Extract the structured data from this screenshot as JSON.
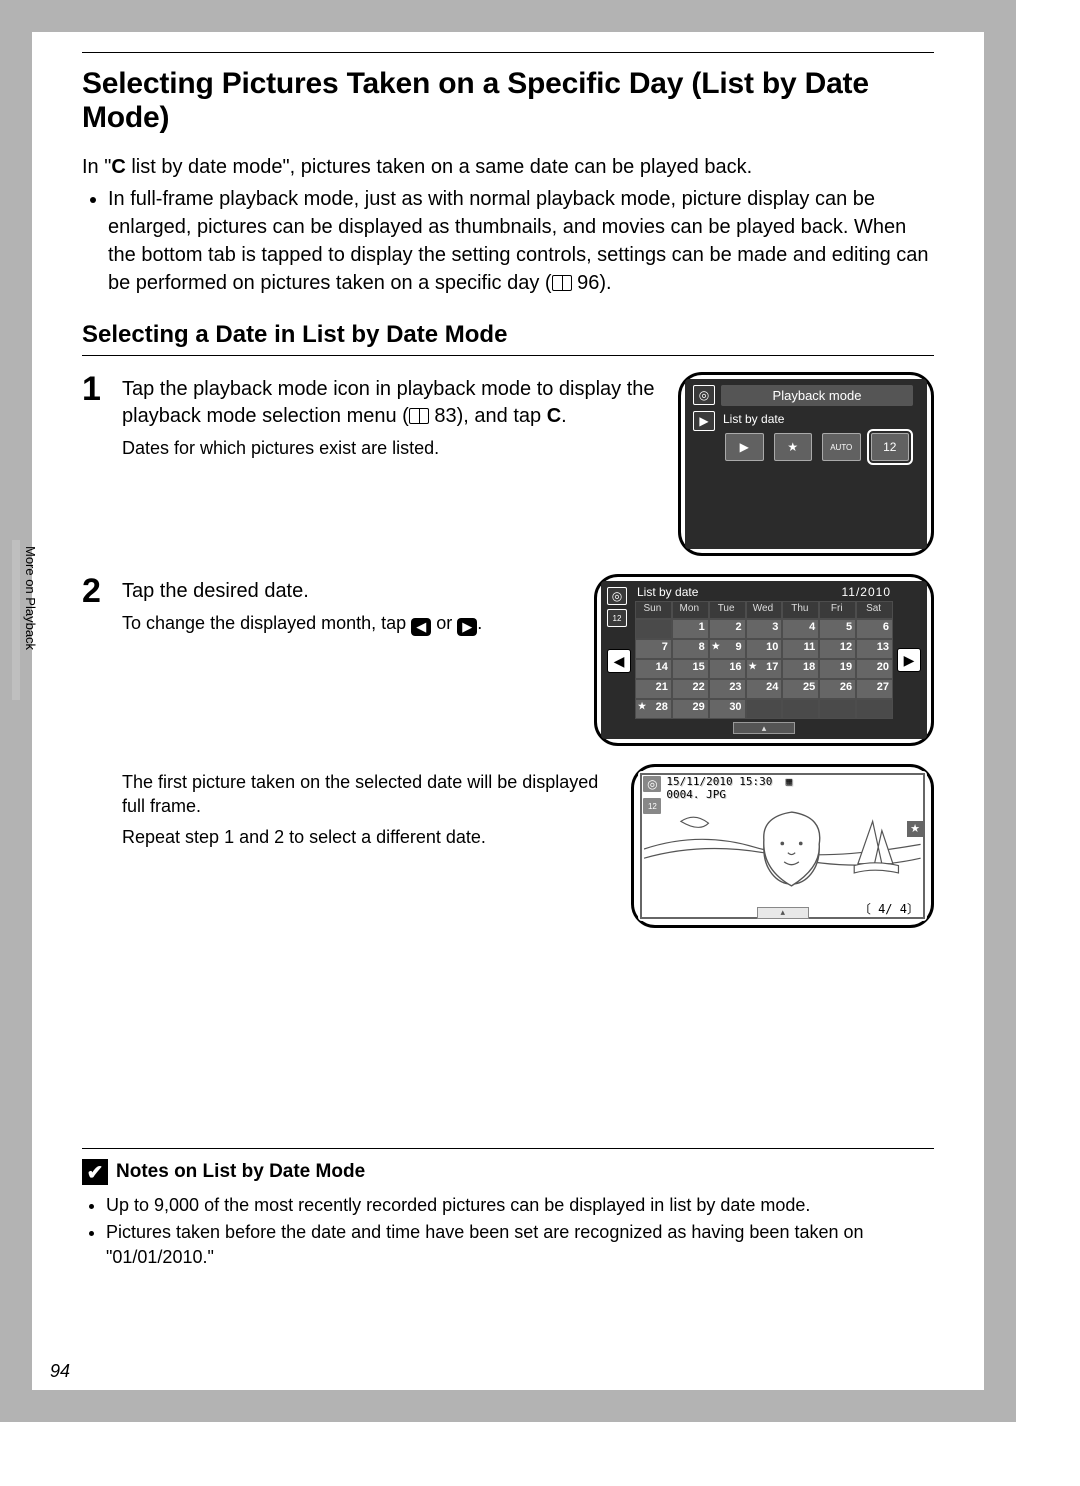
{
  "title": "Selecting Pictures Taken on a Specific Day (List by Date Mode)",
  "intro_prefix": "In \"",
  "intro_mode_icon": "C",
  "intro_suffix": " list by date mode\", pictures taken on a same date can be played back.",
  "bullet1": "In full-frame playback mode, just as with normal playback mode, picture display can be enlarged, pictures can be displayed as thumbnails, and movies can be played back. When the bottom tab is tapped to display the setting controls, settings can be made and editing can be performed on pictures taken on a specific day (",
  "bullet1_pageref": "96",
  "bullet1_close": ").",
  "subtitle": "Selecting a Date in List by Date Mode",
  "side_tab": "More on Playback",
  "step1": {
    "num": "1",
    "lead_a": "Tap the playback mode icon in playback mode to display the playback mode selection menu (",
    "lead_pageref": "83",
    "lead_b": "), and tap ",
    "lead_icon": "C",
    "lead_c": ".",
    "sub": "Dates for which pictures exist are listed."
  },
  "pm_panel": {
    "title": "Playback mode",
    "subtitle": "List by date",
    "buttons": [
      "▶",
      "★",
      "AUTO",
      "12"
    ]
  },
  "step2": {
    "num": "2",
    "lead": "Tap the desired date.",
    "sub_a": "To change the displayed month, tap ",
    "sub_b": " or ",
    "sub_c": "."
  },
  "calendar": {
    "title": "List by date",
    "month": "11/2010",
    "days": [
      "Sun",
      "Mon",
      "Tue",
      "Wed",
      "Thu",
      "Fri",
      "Sat"
    ],
    "weeks": [
      [
        "",
        "1",
        "2",
        "3",
        "4",
        "5",
        "6"
      ],
      [
        "7",
        "8",
        "9",
        "10",
        "11",
        "12",
        "13"
      ],
      [
        "14",
        "15",
        "16",
        "17",
        "18",
        "19",
        "20"
      ],
      [
        "21",
        "22",
        "23",
        "24",
        "25",
        "26",
        "27"
      ],
      [
        "28",
        "29",
        "30",
        "",
        "",
        "",
        ""
      ]
    ],
    "starred": [
      "9",
      "17",
      "28"
    ]
  },
  "step2b": {
    "line1": "The first picture taken on the selected date will be displayed full frame.",
    "line2": "Repeat step 1 and 2 to select a different date."
  },
  "photo": {
    "timestamp": "15/11/2010 15:30",
    "filename": "0004. JPG",
    "counter": "4/     4"
  },
  "notes": {
    "head": "Notes on List by Date Mode",
    "items": [
      "Up to 9,000 of the most recently recorded pictures can be displayed in list by date mode.",
      "Pictures taken before the date and time have been set are recognized as having been taken on \"01/01/2010.\""
    ]
  },
  "page_number": "94"
}
